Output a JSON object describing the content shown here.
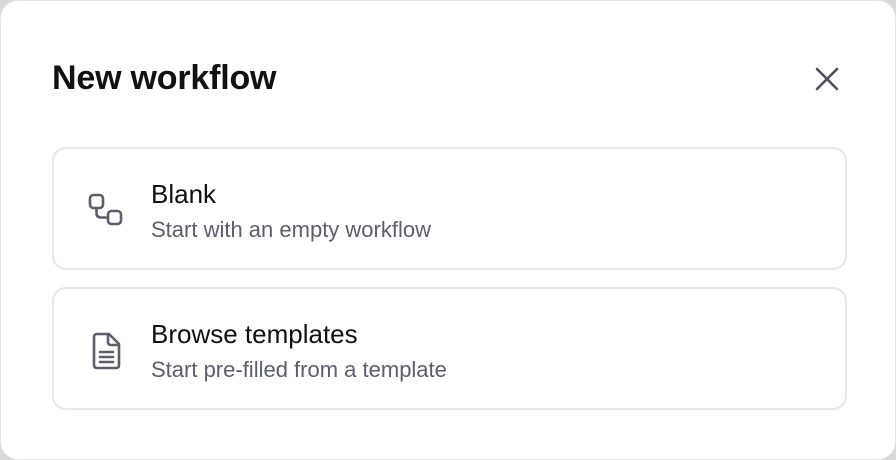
{
  "dialog": {
    "title": "New workflow",
    "close_icon": "close-icon"
  },
  "options": [
    {
      "icon": "workflow-nodes-icon",
      "title": "Blank",
      "description": "Start with an empty workflow"
    },
    {
      "icon": "document-icon",
      "title": "Browse templates",
      "description": "Start pre-filled from a template"
    }
  ],
  "colors": {
    "title_text": "#111114",
    "description_text": "#5b5f6a",
    "icon": "#5b5f6a",
    "card_border": "#e8e8eb"
  }
}
